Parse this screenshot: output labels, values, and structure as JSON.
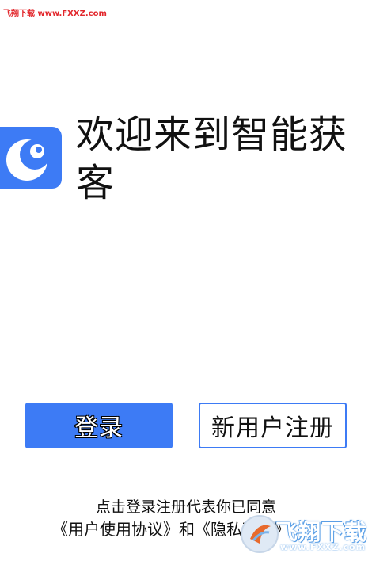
{
  "watermark_top": "飞翔下载 www.FXXZ.com",
  "welcome": {
    "title": "欢迎来到智能获客"
  },
  "buttons": {
    "login_label": "登录",
    "register_label": "新用户注册"
  },
  "agreement": {
    "prefix": "点击登录注册代表你已同意",
    "user_agreement": "《用户使用协议》",
    "conjunction": "和",
    "privacy_policy": "《隐私政策》"
  },
  "watermark_bottom": {
    "site_name": "飞翔下载",
    "site_url": "www.FXXZ.com"
  },
  "colors": {
    "accent": "#3d7bf5",
    "watermark_red": "#e2262b"
  },
  "icons": {
    "app_logo": "crescent-moon-icon"
  }
}
